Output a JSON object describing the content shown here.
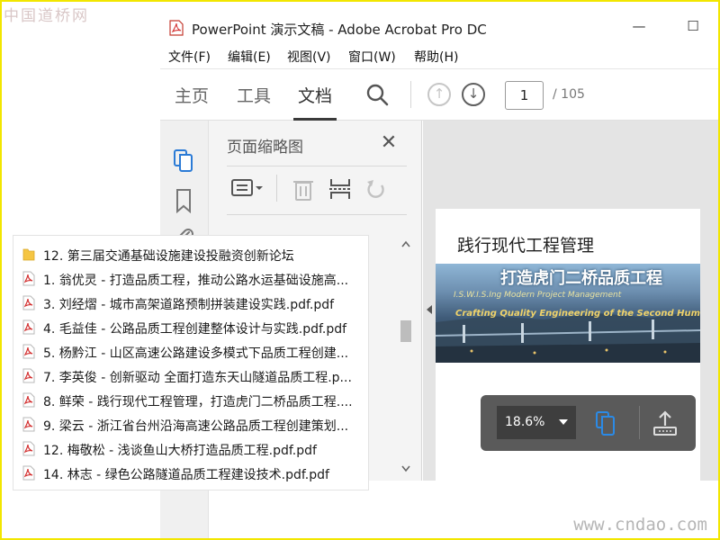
{
  "watermark": {
    "top": "中国道桥网",
    "bottom": "www.cndao.com"
  },
  "window": {
    "title": "PowerPoint 演示文稿 - Adobe Acrobat Pro DC",
    "minimize_glyph": "—",
    "maximize_glyph": "☐"
  },
  "menu": [
    "文件(F)",
    "编辑(E)",
    "视图(V)",
    "窗口(W)",
    "帮助(H)"
  ],
  "toolbar": {
    "tabs": [
      "主页",
      "工具",
      "文档"
    ],
    "active_tab": "文档",
    "page_current": "1",
    "page_total": "/ 105"
  },
  "thumbnail_panel": {
    "title": "页面缩略图",
    "close_glyph": "✕"
  },
  "document": {
    "heading": "践行现代工程管理",
    "banner_title": "打造虎门二桥品质工程",
    "banner_subtitle_en": "I.S.W.I.S.Ing Modern Project Management",
    "banner_tagline_en": "Crafting Quality Engineering of the Second Humen Bri"
  },
  "zoom": {
    "value": "18.6%"
  },
  "file_list": [
    {
      "type": "folder",
      "label": "12. 第三届交通基础设施建设投融资创新论坛"
    },
    {
      "type": "pdf",
      "label": "1. 翁优灵 - 打造品质工程，推动公路水运基础设施高..."
    },
    {
      "type": "pdf",
      "label": "3. 刘经熠 - 城市高架道路预制拼装建设实践.pdf.pdf"
    },
    {
      "type": "pdf",
      "label": "4. 毛益佳 - 公路品质工程创建整体设计与实践.pdf.pdf"
    },
    {
      "type": "pdf",
      "label": "5. 杨黔江 - 山区高速公路建设多模式下品质工程创建..."
    },
    {
      "type": "pdf",
      "label": "7. 李英俊 - 创新驱动 全面打造东天山隧道品质工程.p..."
    },
    {
      "type": "pdf",
      "label": "8. 鲜荣 - 践行现代工程管理，打造虎门二桥品质工程...."
    },
    {
      "type": "pdf",
      "label": "9. 梁云 - 浙江省台州沿海高速公路品质工程创建策划..."
    },
    {
      "type": "pdf",
      "label": "12. 梅敬松 - 浅谈鱼山大桥打造品质工程.pdf.pdf"
    },
    {
      "type": "pdf",
      "label": "14. 林志 - 绿色公路隧道品质工程建设技术.pdf.pdf"
    }
  ],
  "colors": {
    "accent_blue": "#2b7bd6",
    "pdf_red": "#d32f2f",
    "folder_yellow": "#f5c542"
  }
}
